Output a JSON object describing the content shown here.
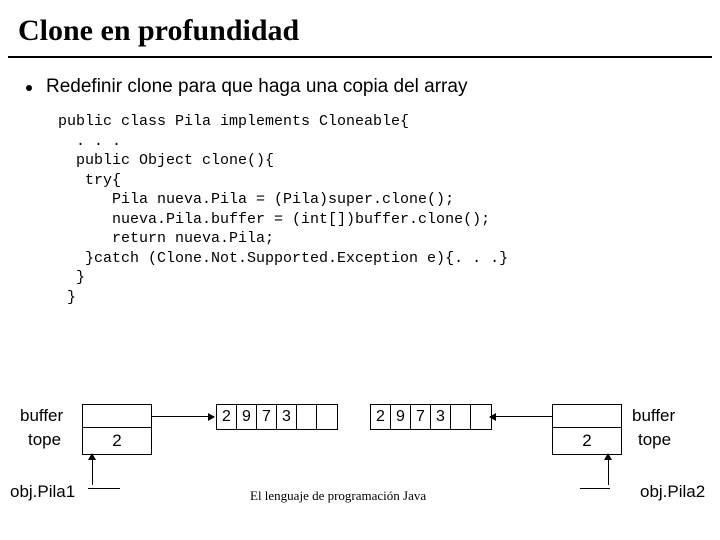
{
  "title": "Clone en profundidad",
  "bullet": "Redefinir clone para que haga una copia del array",
  "code": "public class Pila implements Cloneable{\n  . . .\n  public Object clone(){\n   try{\n      Pila nueva.Pila = (Pila)super.clone();\n      nueva.Pila.buffer = (int[])buffer.clone();\n      return nueva.Pila;\n   }catch (Clone.Not.Supported.Exception e){. . .}\n  }\n }",
  "left": {
    "buffer_label": "buffer",
    "tope_label": "tope",
    "tope_value": "2",
    "obj_label": "obj.Pila1"
  },
  "right": {
    "buffer_label": "buffer",
    "tope_label": "tope",
    "tope_value": "2",
    "obj_label": "obj.Pila2"
  },
  "array1": [
    "2",
    "9",
    "7",
    "3"
  ],
  "array2": [
    "2",
    "9",
    "7",
    "3"
  ],
  "footer": "El lenguaje de programación Java"
}
